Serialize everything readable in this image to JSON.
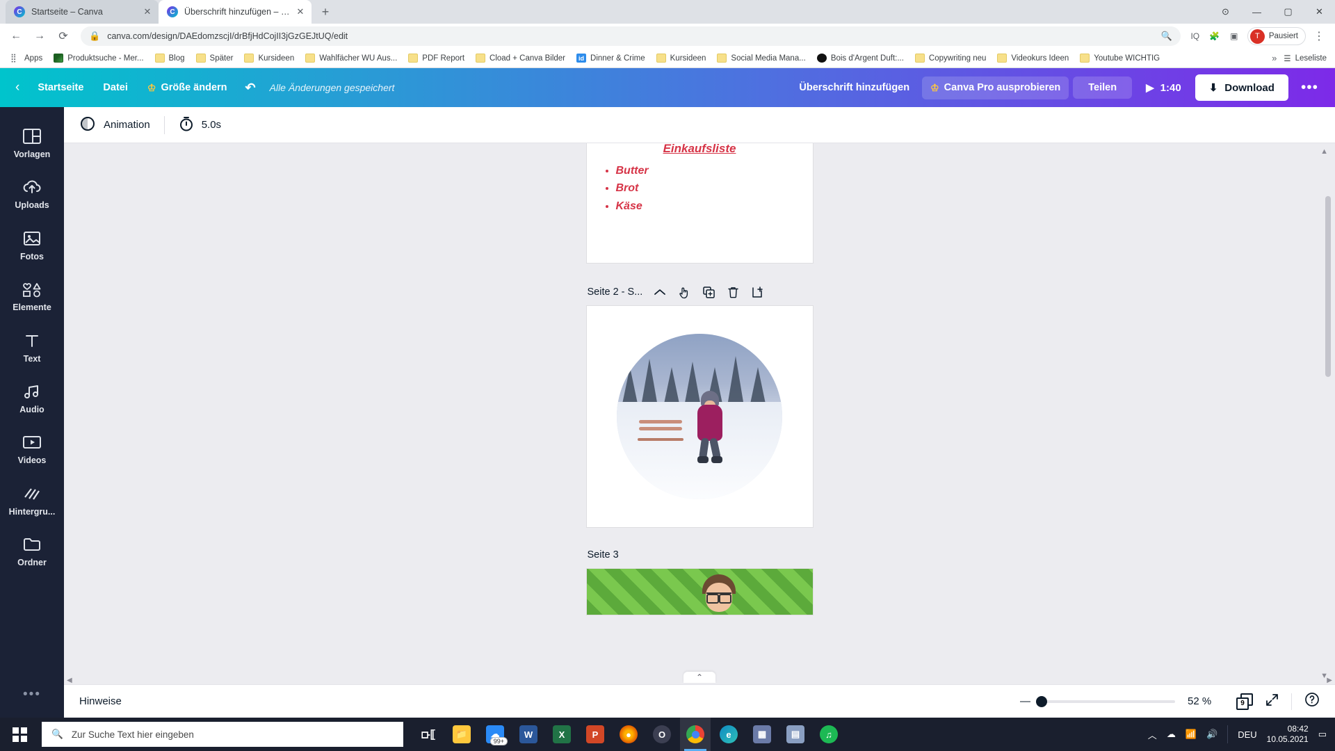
{
  "browser": {
    "tabs": [
      {
        "title": "Startseite – Canva",
        "active": false
      },
      {
        "title": "Überschrift hinzufügen – Logo",
        "active": true
      }
    ],
    "newtab_label": "+",
    "window_controls": {
      "minimize": "—",
      "maximize": "▢",
      "close": "✕"
    },
    "nav": {
      "back": "←",
      "forward": "→",
      "reload": "⟳"
    },
    "omnibox": {
      "lock_icon": "🔒",
      "url": "canva.com/design/DAEdomzscjI/drBfjHdCojII3jGzGEJtUQ/edit",
      "zoom_icon": "⊕",
      "extension_iq": "IQ"
    },
    "profile": {
      "initial": "T",
      "label": "Pausiert"
    },
    "menu_dots": "⋮",
    "bookmarks": {
      "apps_label": "Apps",
      "items": [
        {
          "label": "Produktsuche - Mer...",
          "icon": "image-bookmark-icon"
        },
        {
          "label": "Blog",
          "icon": "folder-icon"
        },
        {
          "label": "Später",
          "icon": "folder-icon"
        },
        {
          "label": "Kursideen",
          "icon": "folder-icon"
        },
        {
          "label": "Wahlfächer WU Aus...",
          "icon": "folder-icon"
        },
        {
          "label": "PDF Report",
          "icon": "folder-icon"
        },
        {
          "label": "Cload + Canva Bilder",
          "icon": "folder-icon"
        },
        {
          "label": "Dinner & Crime",
          "icon": "id-icon"
        },
        {
          "label": "Kursideen",
          "icon": "folder-icon"
        },
        {
          "label": "Social Media Mana...",
          "icon": "folder-icon"
        },
        {
          "label": "Bois d'Argent Duft:...",
          "icon": "black-circle-icon"
        },
        {
          "label": "Copywriting neu",
          "icon": "folder-icon"
        },
        {
          "label": "Videokurs Ideen",
          "icon": "folder-icon"
        },
        {
          "label": "Youtube WICHTIG",
          "icon": "folder-icon"
        }
      ],
      "overflow": "»",
      "reading_list": "Leseliste"
    }
  },
  "canva": {
    "toolbar": {
      "back_icon": "‹",
      "home": "Startseite",
      "file": "Datei",
      "resize": "Größe ändern",
      "undo_icon": "↶",
      "saved_status": "Alle Änderungen gespeichert",
      "design_title": "Überschrift hinzufügen",
      "pro": "Canva Pro ausprobieren",
      "share": "Teilen",
      "play_time": "1:40",
      "download": "Download",
      "more_dots": "•••"
    },
    "sidebar": [
      {
        "label": "Vorlagen",
        "icon": "templates-icon"
      },
      {
        "label": "Uploads",
        "icon": "upload-cloud-icon"
      },
      {
        "label": "Fotos",
        "icon": "photo-icon"
      },
      {
        "label": "Elemente",
        "icon": "shapes-icon"
      },
      {
        "label": "Text",
        "icon": "text-icon"
      },
      {
        "label": "Audio",
        "icon": "music-note-icon"
      },
      {
        "label": "Videos",
        "icon": "video-icon"
      },
      {
        "label": "Hintergru...",
        "icon": "background-icon"
      },
      {
        "label": "Ordner",
        "icon": "folder-icon"
      }
    ],
    "sidebar_more": "•••",
    "animation_bar": {
      "animation_label": "Animation",
      "animation_icon": "animation-icon",
      "timer_icon": "timer-icon",
      "duration": "5.0s"
    },
    "pages": [
      {
        "id": "page-1",
        "title_text": "Einkaufsliste",
        "items": [
          "Butter",
          "Brot",
          "Käse"
        ]
      },
      {
        "id": "page-2",
        "label": "Seite 2 - S...",
        "actions": [
          "collapse-chevron-icon",
          "hand-cursor-icon",
          "duplicate-page-icon",
          "delete-page-icon",
          "add-page-icon"
        ]
      },
      {
        "id": "page-3",
        "label": "Seite 3"
      }
    ],
    "bottom_bar": {
      "notes": "Hinweise",
      "zoom_minus": "—",
      "zoom_value": "52 %",
      "page_count": "9",
      "fullscreen_icon": "expand-icon",
      "help_icon": "?"
    }
  },
  "taskbar": {
    "start_icon": "windows-start-icon",
    "search_placeholder": "Zur Suche Text hier eingeben",
    "search_icon": "search-icon",
    "apps": [
      {
        "name": "task-view-icon",
        "glyph": "❐",
        "color": "#1a1f2e"
      },
      {
        "name": "file-explorer-icon",
        "glyph": "📁",
        "color": "#ffc83d"
      },
      {
        "name": "onedrive-icon",
        "glyph": "☁",
        "color": "#2a8af6",
        "badge": "99+"
      },
      {
        "name": "word-icon",
        "glyph": "W",
        "color": "#2b579a"
      },
      {
        "name": "excel-icon",
        "glyph": "X",
        "color": "#217346"
      },
      {
        "name": "powerpoint-icon",
        "glyph": "P",
        "color": "#d24726"
      },
      {
        "name": "firefox-icon",
        "glyph": "◉",
        "color": "#e66000"
      },
      {
        "name": "opera-icon",
        "glyph": "O",
        "color": "#5a5a6e"
      },
      {
        "name": "chrome-icon",
        "glyph": "◎",
        "color": "#f4b400",
        "active": true
      },
      {
        "name": "edge-icon",
        "glyph": "e",
        "color": "#0f8bc4"
      },
      {
        "name": "photos-icon",
        "glyph": "▨",
        "color": "#6b7ba8"
      },
      {
        "name": "store-icon",
        "glyph": "▤",
        "color": "#8a9fc2"
      },
      {
        "name": "spotify-icon",
        "glyph": "♫",
        "color": "#1db954"
      }
    ],
    "tray": {
      "chevron": "︿",
      "network_icon": "📶",
      "volume_icon": "🔊",
      "onedrive_icon": "☁",
      "lang": "DEU",
      "time": "08:42",
      "date": "10.05.2021",
      "notification_icon": "▭"
    }
  }
}
